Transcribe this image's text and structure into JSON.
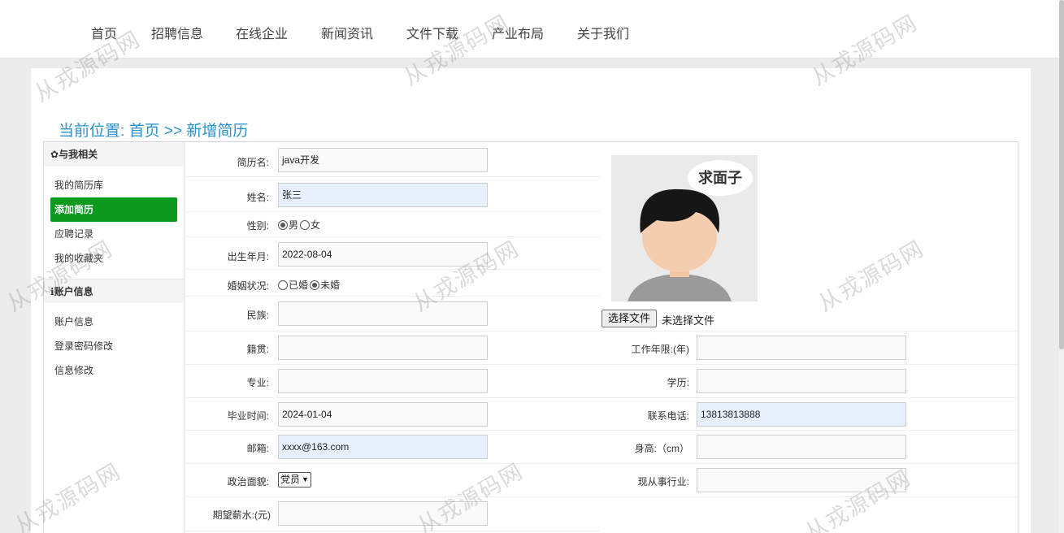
{
  "nav": [
    "首页",
    "招聘信息",
    "在线企业",
    "新闻资讯",
    "文件下载",
    "产业布局",
    "关于我们"
  ],
  "breadcrumb": {
    "prefix": "当前位置:",
    "home": "首页",
    "sep": ">>",
    "current": "新增简历"
  },
  "sidebar": {
    "section1_title": "与我相关",
    "section1_icon": "gear-icon",
    "items1": [
      "我的简历库",
      "添加简历",
      "应聘记录",
      "我的收藏夹"
    ],
    "active_item": "添加简历",
    "section2_title": "账户信息",
    "section2_icon": "info-icon",
    "items2": [
      "账户信息",
      "登录密码修改",
      "信息修改"
    ]
  },
  "form": {
    "resume_name": {
      "label": "简历名:",
      "value": "java开发"
    },
    "name": {
      "label": "姓名:",
      "value": "张三"
    },
    "gender": {
      "label": "性别:",
      "options": [
        "男",
        "女"
      ],
      "selected": "男"
    },
    "birth": {
      "label": "出生年月:",
      "value": "2022-08-04"
    },
    "marital": {
      "label": "婚姻状况:",
      "options": [
        "已婚",
        "未婚"
      ],
      "selected": "未婚"
    },
    "ethnicity": {
      "label": "民族:",
      "value": ""
    },
    "native_place": {
      "label": "籍贯:",
      "value": ""
    },
    "work_years": {
      "label": "工作年限:(年)",
      "value": ""
    },
    "major": {
      "label": "专业:",
      "value": ""
    },
    "education": {
      "label": "学历:",
      "value": ""
    },
    "grad_time": {
      "label": "毕业时间:",
      "value": "2024-01-04"
    },
    "phone": {
      "label": "联系电话:",
      "value": "13813813888"
    },
    "email": {
      "label": "邮箱:",
      "value": "xxxx@163.com"
    },
    "height": {
      "label": "身高:（cm）",
      "value": ""
    },
    "political": {
      "label": "政治面貌:",
      "value": "党员"
    },
    "industry": {
      "label": "现从事行业:",
      "value": ""
    },
    "salary": {
      "label": "期望薪水:(元)",
      "value": ""
    }
  },
  "photo": {
    "bubble_text": "求面子",
    "file_button": "选择文件",
    "file_status": "未选择文件"
  },
  "watermark": "从戎源码网"
}
